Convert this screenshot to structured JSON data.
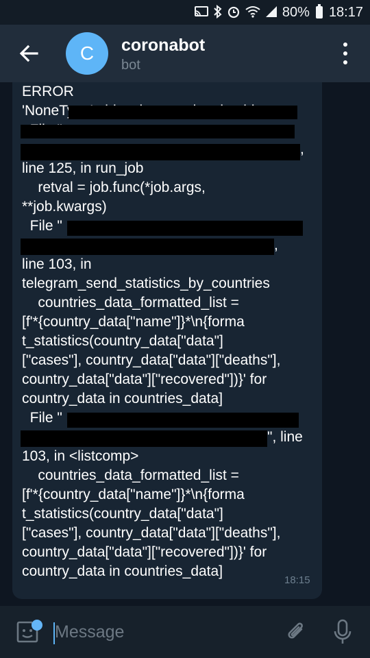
{
  "status_bar": {
    "battery": "80%",
    "time": "18:17"
  },
  "header": {
    "back_icon": "arrow-left-icon",
    "avatar_letter": "C",
    "avatar_color": "#5eb5f7",
    "title": "coronabot",
    "subtitle": "bot",
    "menu_icon": "more-vert-icon"
  },
  "message": {
    "lines": [
      "ERROR",
      "'NoneType' object is not subscriptable",
      "  File \"",
      ",",
      "line 125, in run_job",
      "    retval = job.func(*job.args,",
      "**job.kwargs)",
      "  File \"",
      ",",
      "line 103, in",
      "telegram_send_statistics_by_countries",
      "    countries_data_formatted_list =",
      "[f'*{country_data[\"name\"]}*\\n{forma",
      "t_statistics(country_data[\"data\"]",
      "[\"cases\"], country_data[\"data\"][\"deaths\"],",
      "country_data[\"data\"][\"recovered\"])}' for",
      "country_data in countries_data]",
      "  File \"",
      "\", line",
      "103, in <listcomp>",
      "    countries_data_formatted_list =",
      "[f'*{country_data[\"name\"]}*\\n{forma",
      "t_statistics(country_data[\"data\"]",
      "[\"cases\"], country_data[\"data\"][\"deaths\"],",
      "country_data[\"data\"][\"recovered\"])}' for",
      "country_data in countries_data]"
    ],
    "time": "18:15"
  },
  "composer": {
    "placeholder": "Message",
    "sticker_icon": "sticker-icon",
    "attach_icon": "paperclip-icon",
    "mic_icon": "microphone-icon",
    "accent": "#64b5f6"
  }
}
